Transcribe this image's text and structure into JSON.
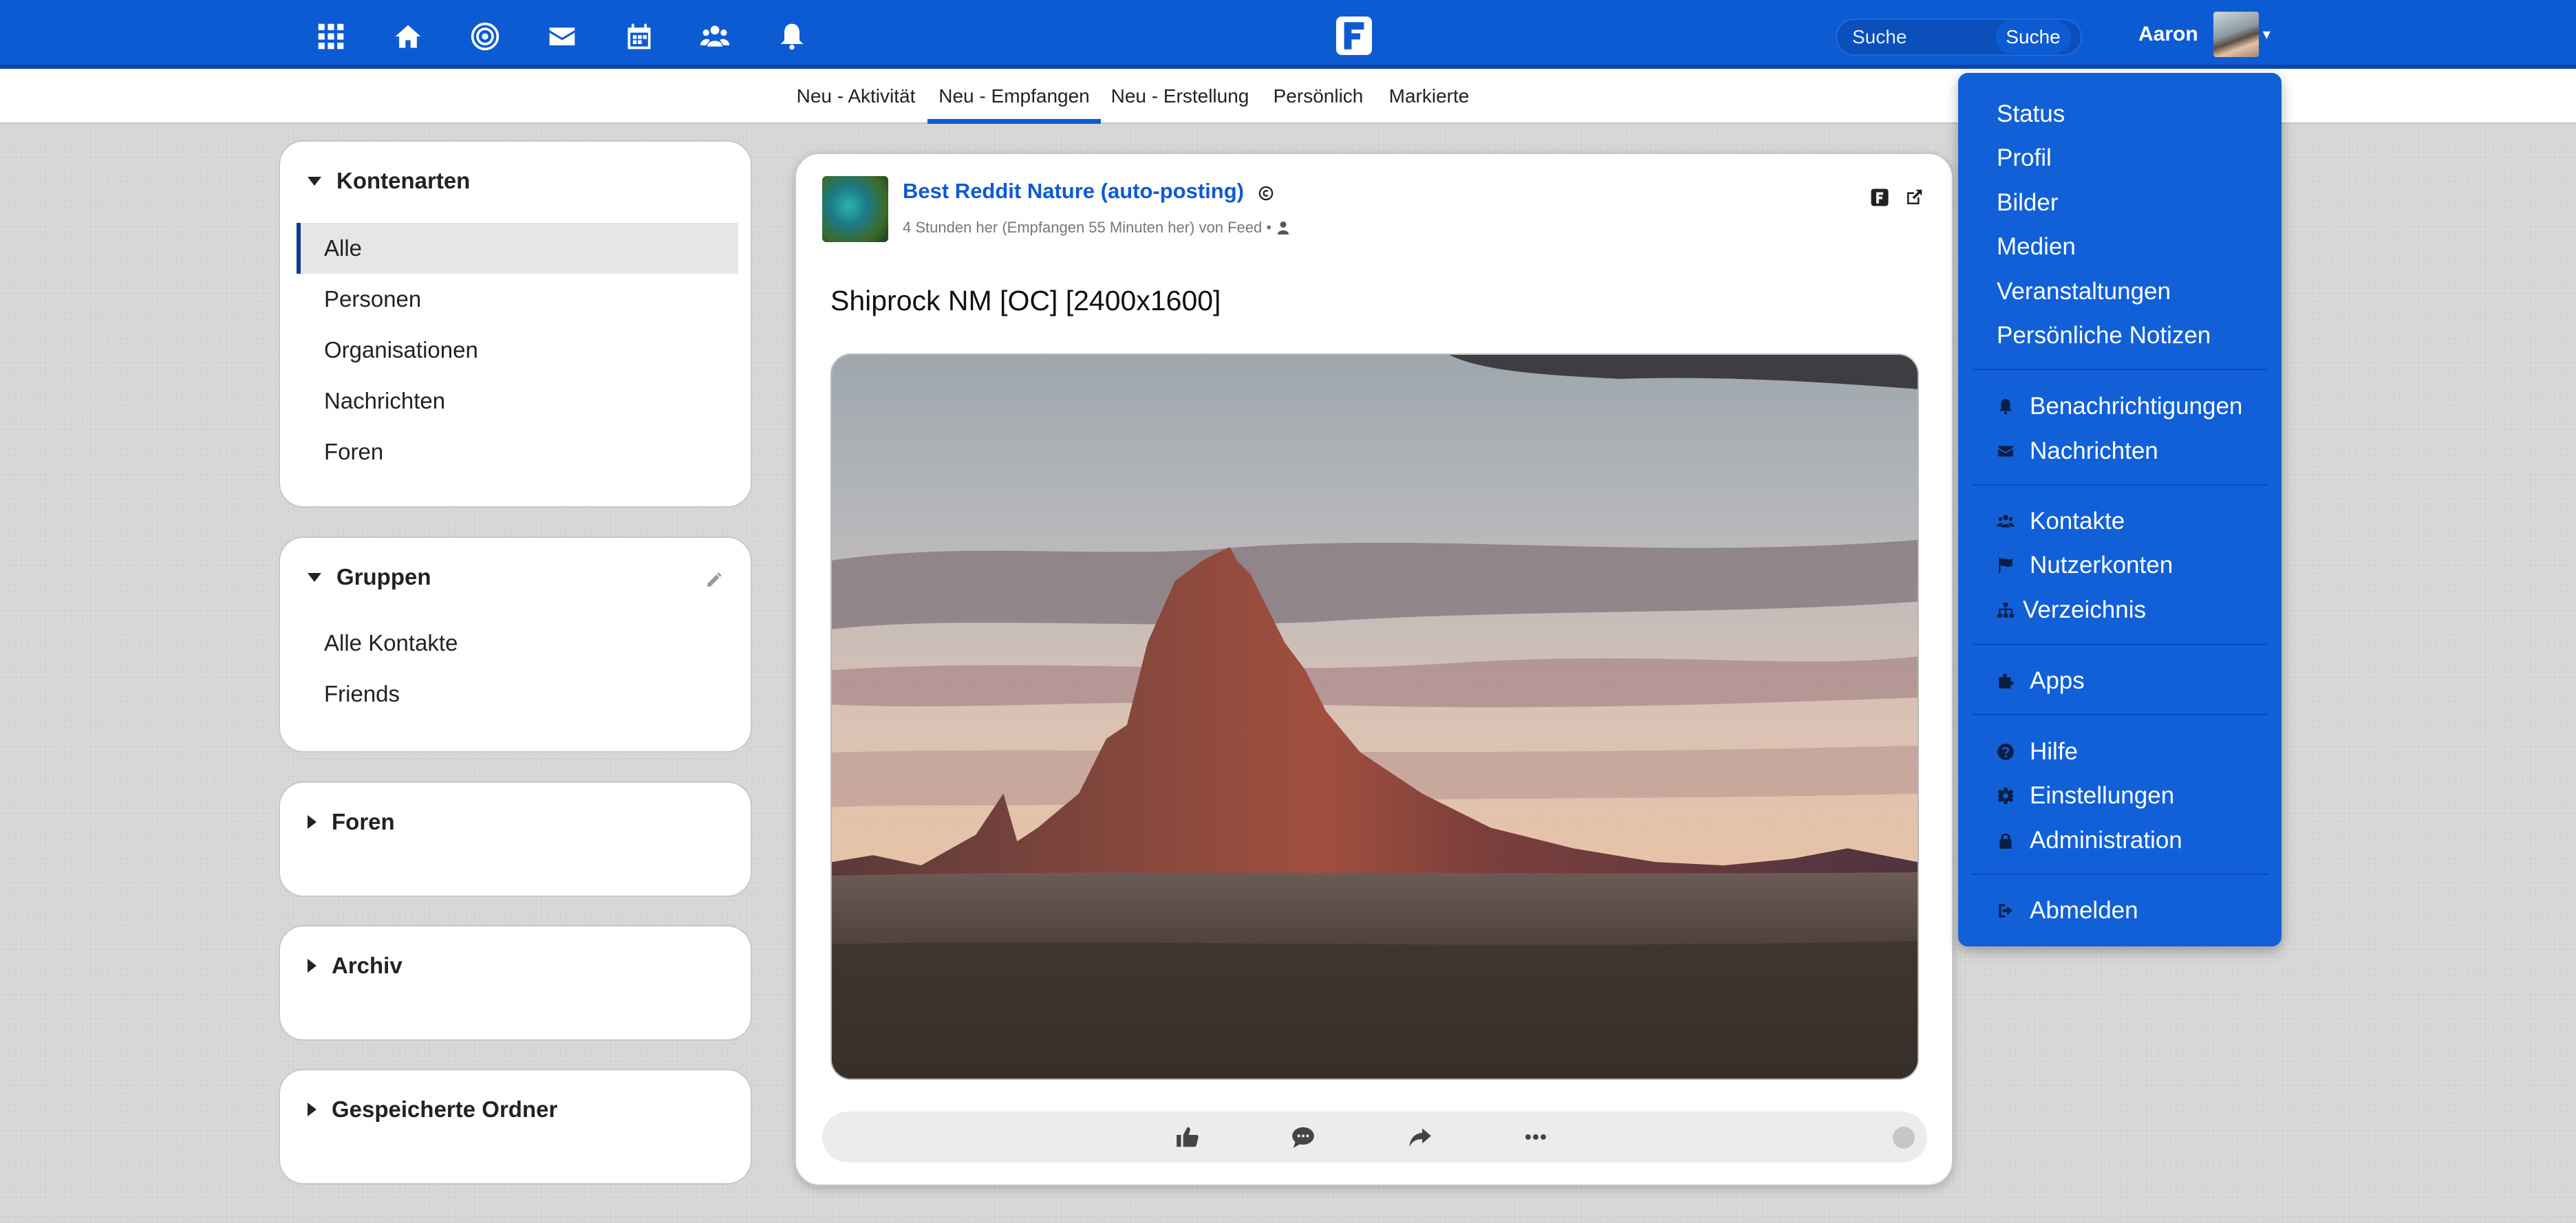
{
  "topbar": {
    "icons": [
      "apps-grid-icon",
      "home-icon",
      "network-target-icon",
      "messages-envelope-icon",
      "calendar-icon",
      "contacts-group-icon",
      "notifications-bell-icon"
    ],
    "brand": "friendica-logo-icon",
    "search_placeholder": "Suche",
    "search_button": "Suche",
    "user_name": "Aaron",
    "accent_color": "#0d5bd2"
  },
  "tabs": [
    {
      "label": "Neu - Aktivität",
      "active": false
    },
    {
      "label": "Neu - Empfangen",
      "active": true
    },
    {
      "label": "Neu - Erstellung",
      "active": false
    },
    {
      "label": "Persönlich",
      "active": false
    },
    {
      "label": "Markierte",
      "active": false
    }
  ],
  "sidebar": {
    "account_types": {
      "title": "Kontenarten",
      "items": [
        "Alle",
        "Personen",
        "Organisationen",
        "Nachrichten",
        "Foren"
      ],
      "selected": "Alle"
    },
    "groups": {
      "title": "Gruppen",
      "items": [
        "Alle Kontakte",
        "Friends"
      ]
    },
    "forums": {
      "title": "Foren"
    },
    "archive": {
      "title": "Archiv"
    },
    "saved_folders": {
      "title": "Gespeicherte Ordner"
    }
  },
  "post": {
    "author": "Best Reddit Nature (auto-posting)",
    "meta": "4 Stunden her (Empfangen 55 Minuten her) von Feed •",
    "title": "Shiprock NM [OC] [2400x1600]",
    "actions": [
      "like-icon",
      "comment-icon",
      "share-icon",
      "more-icon"
    ]
  },
  "dropdown": {
    "items": [
      {
        "label": "Status",
        "icon": ""
      },
      {
        "label": "Profil",
        "icon": ""
      },
      {
        "label": "Bilder",
        "icon": ""
      },
      {
        "label": "Medien",
        "icon": ""
      },
      {
        "label": "Veranstaltungen",
        "icon": ""
      },
      {
        "label": "Persönliche Notizen",
        "icon": ""
      },
      {
        "label": "Benachrichtigungen",
        "icon": "bell-icon"
      },
      {
        "label": "Nachrichten",
        "icon": "envelope-icon"
      },
      {
        "label": "Kontakte",
        "icon": "users-icon"
      },
      {
        "label": "Nutzerkonten",
        "icon": "flag-icon"
      },
      {
        "label": "Verzeichnis",
        "icon": "sitemap-icon"
      },
      {
        "label": "Apps",
        "icon": "puzzle-icon"
      },
      {
        "label": "Hilfe",
        "icon": "question-icon"
      },
      {
        "label": "Einstellungen",
        "icon": "gear-icon"
      },
      {
        "label": "Administration",
        "icon": "lock-icon"
      },
      {
        "label": "Abmelden",
        "icon": "sign-out-icon"
      }
    ]
  }
}
